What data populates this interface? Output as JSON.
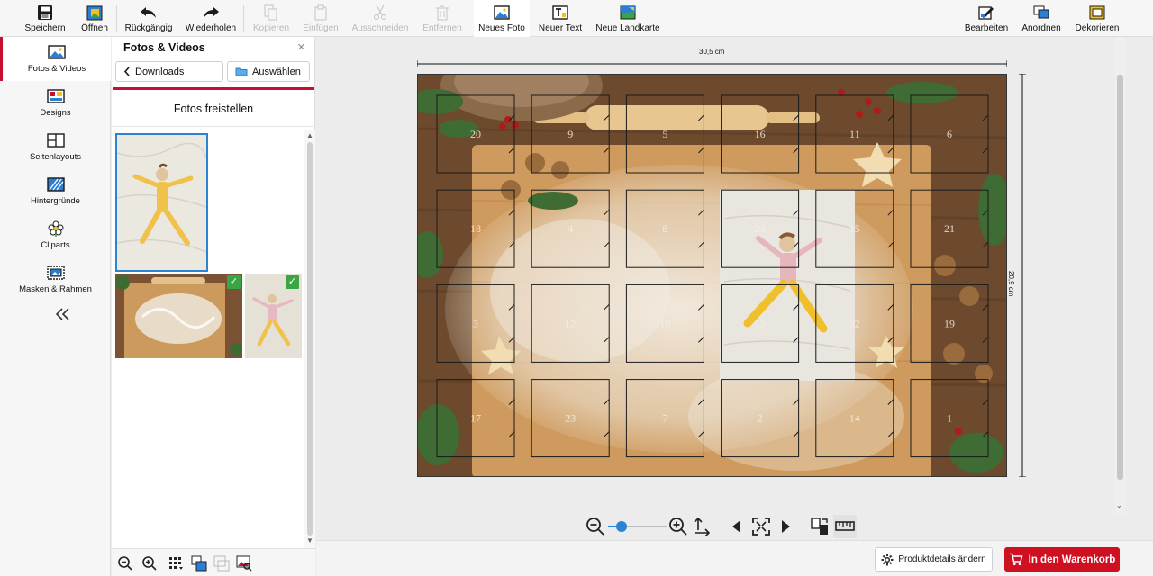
{
  "toolbar": {
    "save": "Speichern",
    "open": "Öffnen",
    "undo": "Rückgängig",
    "redo": "Wiederholen",
    "copy": "Kopieren",
    "paste": "Einfügen",
    "cut": "Ausschneiden",
    "remove": "Entfernen",
    "new_photo": "Neues Foto",
    "new_text": "Neuer Text",
    "new_map": "Neue Landkarte",
    "edit": "Bearbeiten",
    "arrange": "Anordnen",
    "decorate": "Dekorieren"
  },
  "sidebar": {
    "items": [
      {
        "label": "Fotos & Videos",
        "icon": "photo-icon",
        "active": true
      },
      {
        "label": "Designs",
        "icon": "designs-icon"
      },
      {
        "label": "Seitenlayouts",
        "icon": "layout-icon"
      },
      {
        "label": "Hintergründe",
        "icon": "background-icon"
      },
      {
        "label": "Cliparts",
        "icon": "clipart-icon"
      },
      {
        "label": "Masken & Rahmen",
        "icon": "mask-frame-icon"
      }
    ]
  },
  "panel": {
    "title": "Fotos & Videos",
    "back_label": "Downloads",
    "select_label": "Auswählen",
    "cutout_label": "Fotos freistellen"
  },
  "canvas": {
    "width_label": "30,5 cm",
    "height_label": "20,9 cm",
    "door_numbers": [
      [
        "20",
        "9",
        "5",
        "16",
        "11",
        "6"
      ],
      [
        "18",
        "4",
        "8",
        "24",
        "15",
        "21"
      ],
      [
        "3",
        "12",
        "10",
        "13",
        "22",
        "19"
      ],
      [
        "17",
        "23",
        "7",
        "2",
        "14",
        "1"
      ]
    ]
  },
  "zoom": {
    "level": 0.22
  },
  "bottom": {
    "details_label": "Produktdetails ändern",
    "cart_label": "In den Warenkorb"
  },
  "colors": {
    "accent": "#c8102e",
    "cart": "#cf1020",
    "check": "#3aa543",
    "selection": "#2a84d2"
  }
}
